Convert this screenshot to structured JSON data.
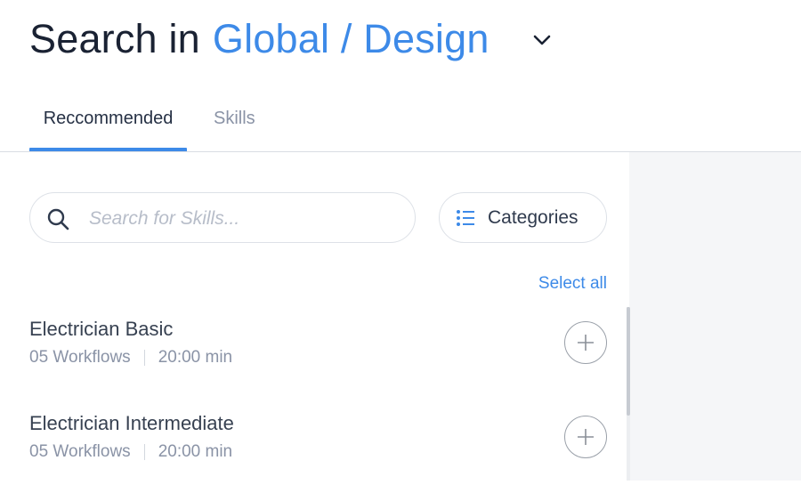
{
  "header": {
    "prefix": "Search in",
    "scope": "Global / Design",
    "toggle_icon": "chevron-down-icon"
  },
  "tabs": [
    {
      "label": "Reccommended",
      "active": true
    },
    {
      "label": "Skills",
      "active": false
    }
  ],
  "search": {
    "placeholder": "Search for Skills...",
    "value": "",
    "icon": "search-icon"
  },
  "categories": {
    "label": "Categories",
    "icon": "list-icon"
  },
  "select_all": "Select all",
  "items": [
    {
      "title": "Electrician Basic",
      "workflows": "05 Workflows",
      "duration": "20:00 min",
      "action_icon": "plus-circle-icon"
    },
    {
      "title": "Electrician Intermediate",
      "workflows": "05 Workflows",
      "duration": "20:00 min",
      "action_icon": "plus-circle-icon"
    }
  ],
  "colors": {
    "accent": "#3d8ae8",
    "title": "#1a2233",
    "muted": "#8a93a6",
    "panel": "#f5f6f8"
  }
}
